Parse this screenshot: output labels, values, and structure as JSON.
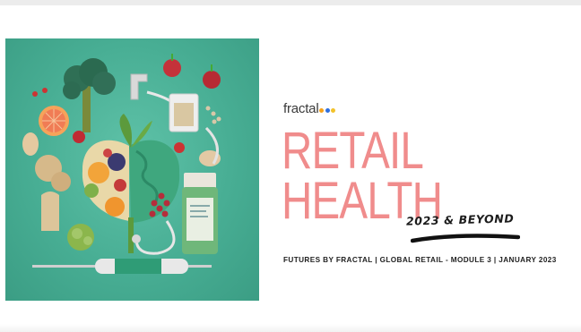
{
  "brand": {
    "name": "fractal",
    "dot_colors": [
      "#f6a21a",
      "#2f6fde",
      "#f2c22b"
    ]
  },
  "title": {
    "line1": "RETAIL",
    "line2": "HEALTH",
    "color": "#f08c8c"
  },
  "tagline": "2023 & BEYOND",
  "subtitle": "FUTURES BY FRACTAL  |  GLOBAL RETAIL - MODULE 3  |  JANUARY 2023",
  "hero_image": {
    "background_color": "#4bb095",
    "icon": "food-and-health-illustration-icon"
  }
}
